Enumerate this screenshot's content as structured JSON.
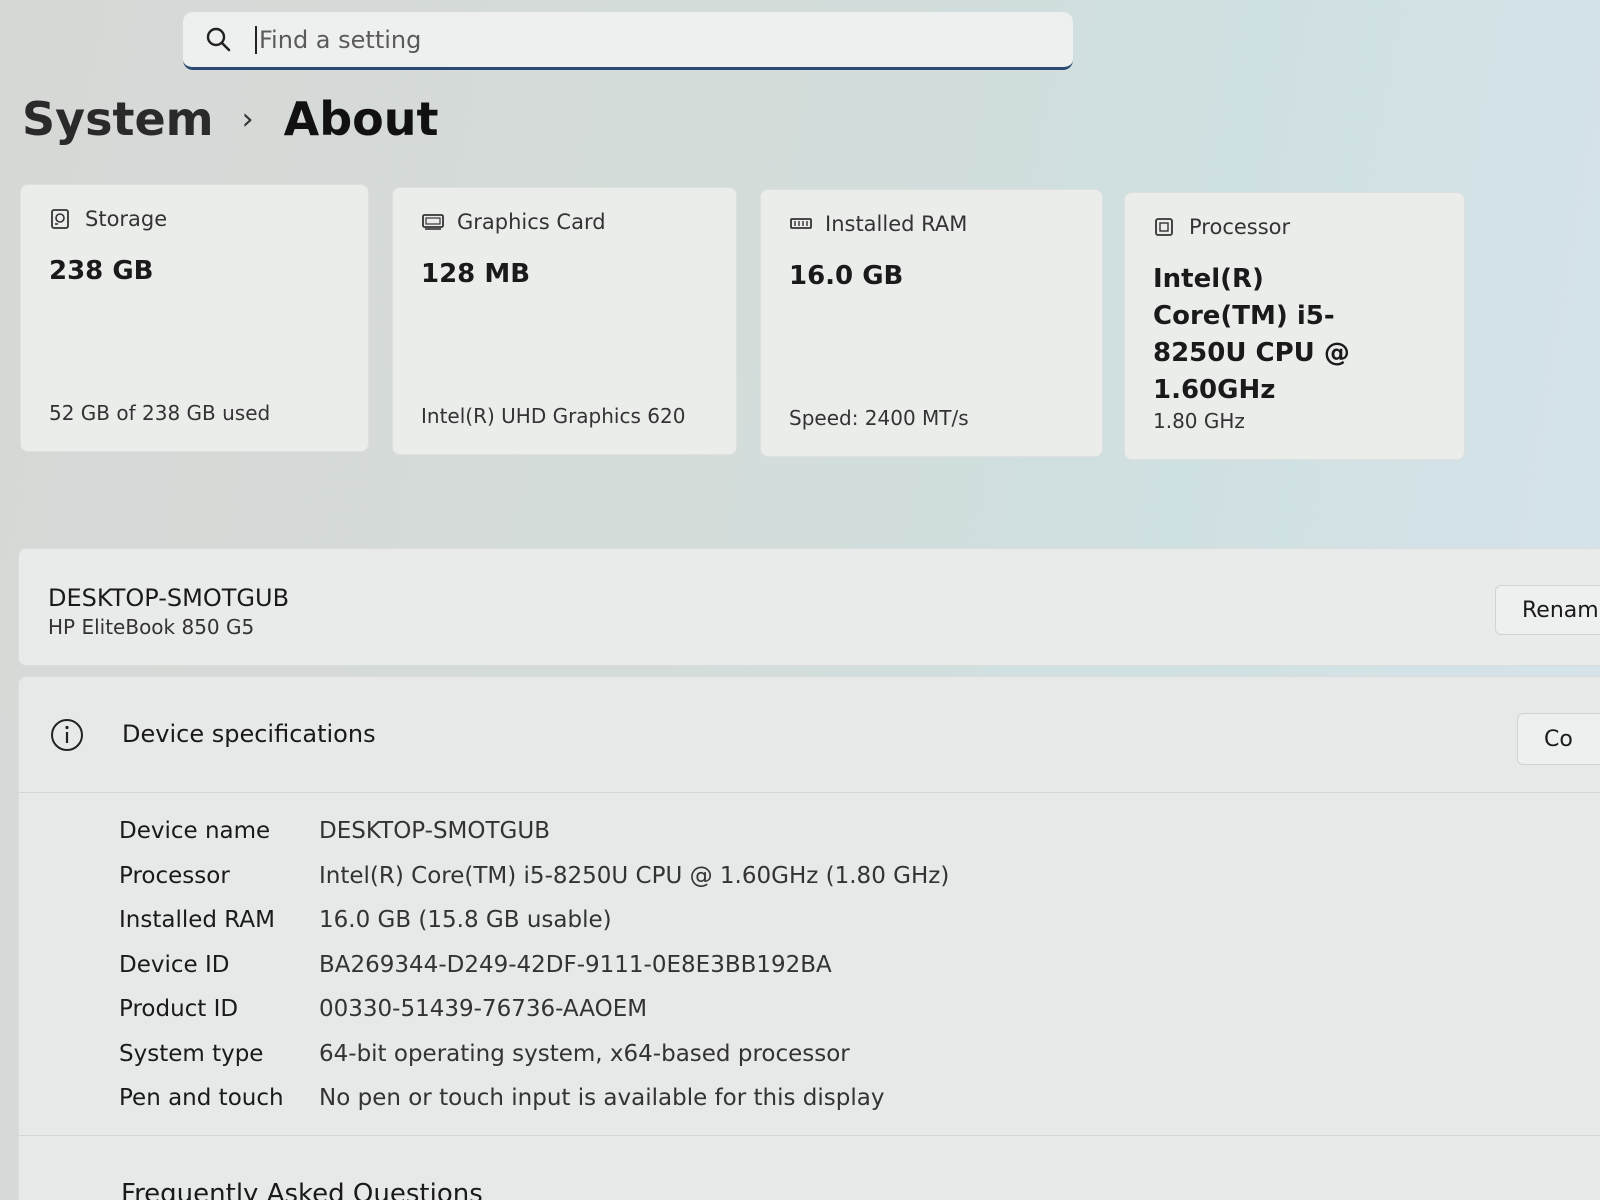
{
  "search": {
    "placeholder": "Find a setting"
  },
  "breadcrumb": {
    "parent": "System",
    "current": "About"
  },
  "cards": [
    {
      "icon": "storage-icon",
      "title": "Storage",
      "value": "238 GB",
      "sub": "52 GB of 238 GB used"
    },
    {
      "icon": "graphics-card-icon",
      "title": "Graphics Card",
      "value": "128 MB",
      "sub": "Intel(R) UHD Graphics 620"
    },
    {
      "icon": "ram-icon",
      "title": "Installed RAM",
      "value": "16.0 GB",
      "sub": "Speed: 2400 MT/s"
    },
    {
      "icon": "processor-icon",
      "title": "Processor",
      "value": "Intel(R) Core(TM) i5-8250U CPU @ 1.60GHz",
      "sub": "1.80 GHz"
    }
  ],
  "device": {
    "name": "DESKTOP-SMOTGUB",
    "model": "HP EliteBook 850 G5",
    "rename_label": "Renam"
  },
  "specs": {
    "title": "Device specifications",
    "copy_label": "Co",
    "rows": [
      {
        "label": "Device name",
        "value": "DESKTOP-SMOTGUB"
      },
      {
        "label": "Processor",
        "value": "Intel(R) Core(TM) i5-8250U CPU @ 1.60GHz (1.80 GHz)"
      },
      {
        "label": "Installed RAM",
        "value": "16.0 GB (15.8 GB usable)"
      },
      {
        "label": "Device ID",
        "value": "BA269344-D249-42DF-9111-0E8E3BB192BA"
      },
      {
        "label": "Product ID",
        "value": "00330-51439-76736-AAOEM"
      },
      {
        "label": "System type",
        "value": "64-bit operating system, x64-based processor"
      },
      {
        "label": "Pen and touch",
        "value": "No pen or touch input is available for this display"
      }
    ]
  },
  "faq": {
    "title": "Frequently Asked Questions"
  }
}
